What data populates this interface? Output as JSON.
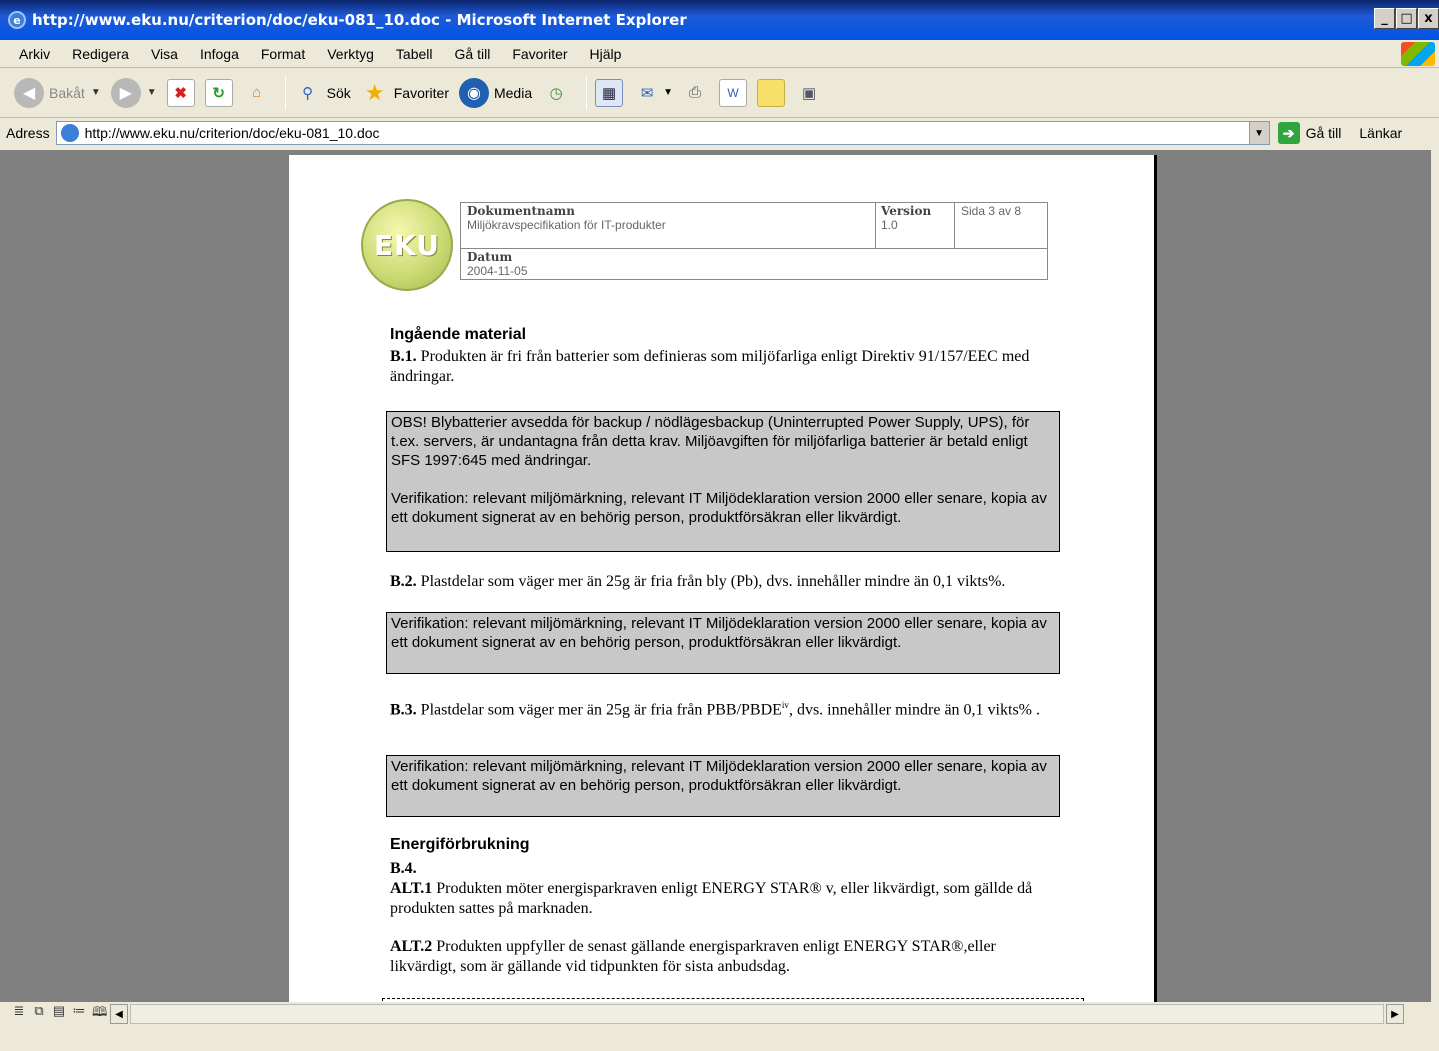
{
  "window": {
    "title": "http://www.eku.nu/criterion/doc/eku-081_10.doc - Microsoft Internet Explorer",
    "controls": [
      "_",
      "□",
      "x"
    ]
  },
  "menu": [
    "Arkiv",
    "Redigera",
    "Visa",
    "Infoga",
    "Format",
    "Verktyg",
    "Tabell",
    "Gå till",
    "Favoriter",
    "Hjälp"
  ],
  "toolbar": {
    "back": "Bakåt",
    "search": "Sök",
    "favorites": "Favoriter",
    "media": "Media"
  },
  "address": {
    "label": "Adress",
    "url": "http://www.eku.nu/criterion/doc/eku-081_10.doc",
    "go": "Gå till",
    "links": "Länkar"
  },
  "doc_header": {
    "logo": "EKU",
    "name_label": "Dokumentnamn",
    "name_value": "Miljökravspecifikation för IT-produkter",
    "version_label": "Version",
    "version_value": "1.0",
    "page": "Sida 3 av 8",
    "date_label": "Datum",
    "date_value": "2004-11-05"
  },
  "doc": {
    "h1": "Ingående material",
    "b1_num": "B.1.",
    "b1_text": " Produkten är fri från batterier som definieras som miljöfarliga enligt Direktiv 91/157/EEC med ändringar.",
    "note1_p1": "OBS! Blybatterier avsedda för backup / nödlägesbackup (Uninterrupted Power Supply, UPS), för t.ex. servers, är undantagna från detta krav. Miljöavgiften för miljöfarliga batterier är betald enligt SFS 1997:645 med ändringar.",
    "note1_p2": "Verifikation: relevant miljömärkning, relevant IT Miljödeklaration version 2000 eller senare, kopia av ett dokument signerat av en behörig person, produktförsäkran eller likvärdigt.",
    "b2_num": "B.2.",
    "b2_text": " Plastdelar som väger mer än 25g är fria från bly (Pb), dvs. innehåller mindre än 0,1 vikts%.",
    "note2": "Verifikation: relevant miljömärkning, relevant IT Miljödeklaration version 2000 eller senare, kopia av ett dokument signerat av en behörig person, produktförsäkran eller likvärdigt.",
    "b3_num": "B.3.",
    "b3_text": " Plastdelar som väger mer än 25g är fria från PBB/PBDE",
    "b3_sup": "iv",
    "b3_text2": ", dvs. innehåller mindre än 0,1 vikts% .",
    "note3": "Verifikation: relevant miljömärkning, relevant IT Miljödeklaration version 2000 eller senare, kopia av ett dokument signerat av en behörig person, produktförsäkran eller likvärdigt.",
    "h2": "Energiförbrukning",
    "b4_num": "B.4.",
    "alt1_label": "ALT.1",
    "alt1_text": " Produkten möter energisparkraven enligt ENERGY STAR® v, eller likvärdigt, som gällde då produkten sattes på marknaden.",
    "alt2_label": "ALT.2",
    "alt2_text": " Produkten uppfyller de senast gällande energisparkraven enligt ENERGY STAR®,eller likvärdigt, som är gällande vid tidpunkten för sista anbudsdag."
  },
  "status": {
    "view_icons": [
      "≣",
      "⧉",
      "▤",
      "≔",
      "🕮"
    ]
  }
}
